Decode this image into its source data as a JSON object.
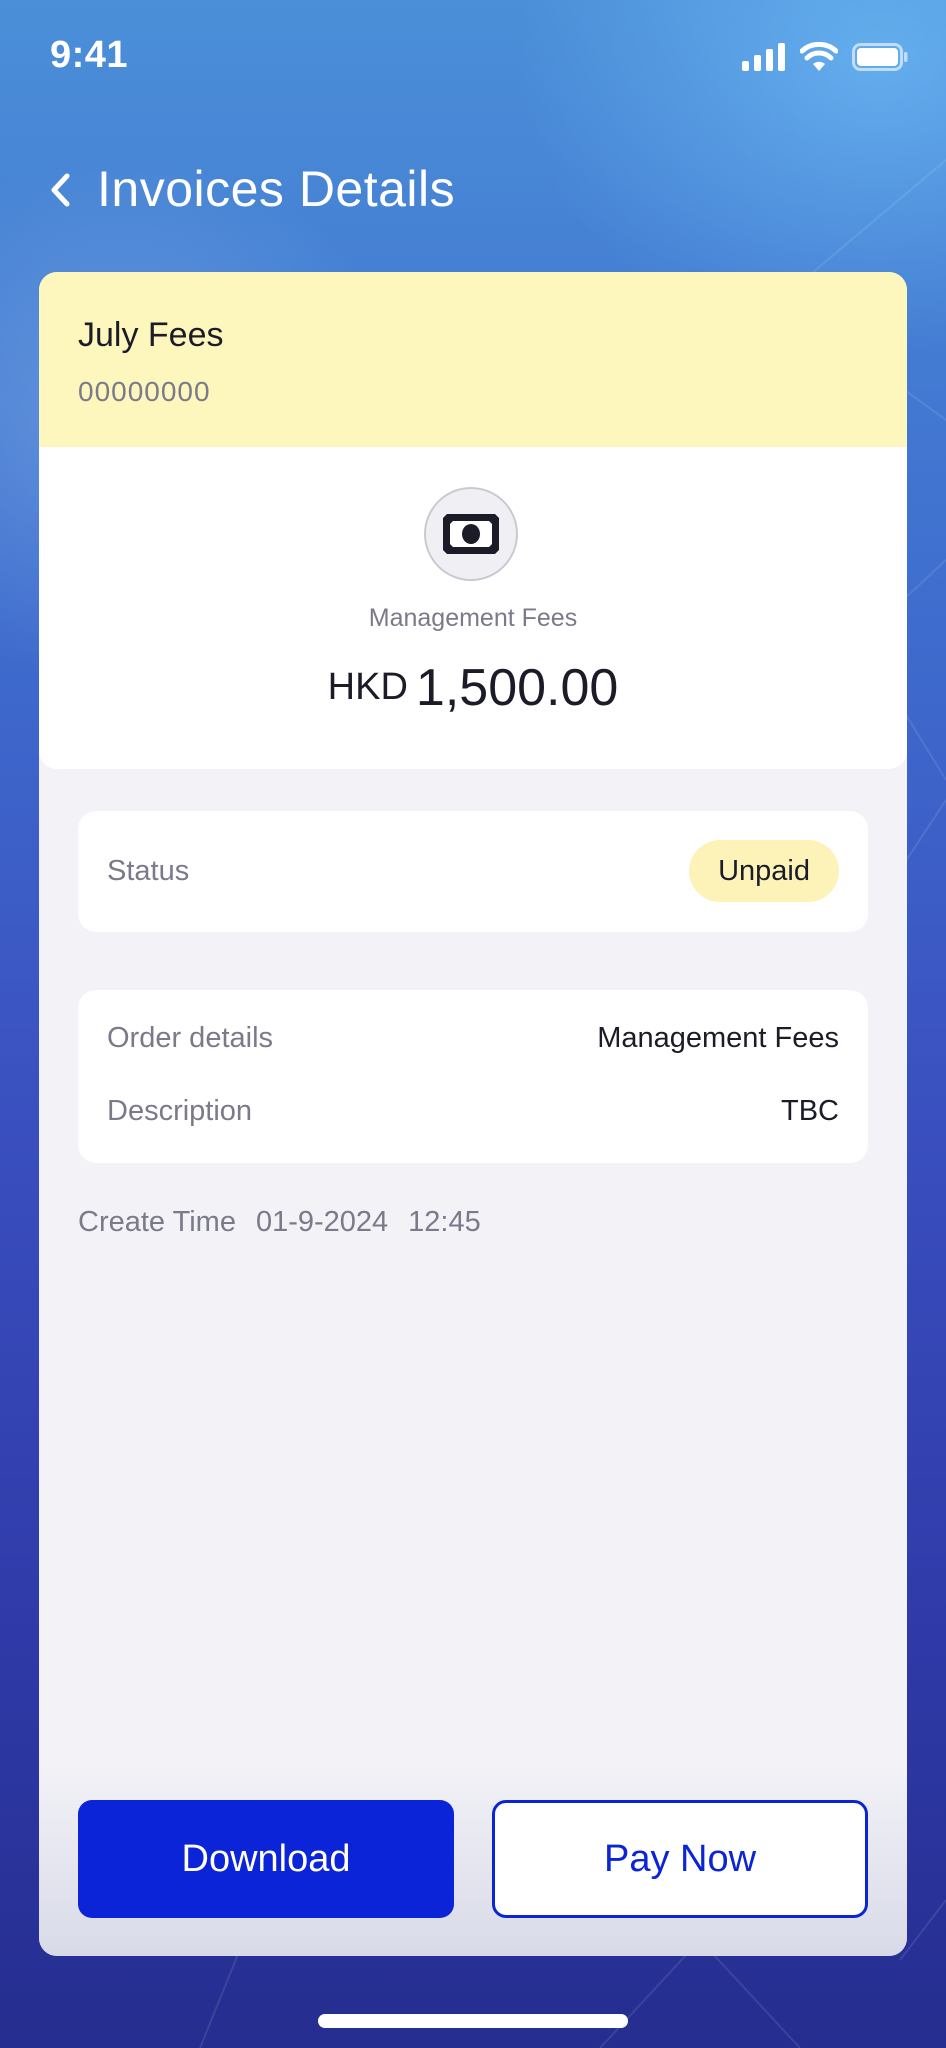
{
  "status_bar": {
    "time": "9:41",
    "icons": [
      "signal-icon",
      "wifi-icon",
      "battery-icon"
    ]
  },
  "header": {
    "title": "Invoices Details",
    "back_icon": "chevron-left-icon"
  },
  "invoice": {
    "name": "July Fees",
    "number": "00000000",
    "icon": "cash-icon",
    "category": "Management Fees",
    "currency": "HKD",
    "amount": "1,500.00"
  },
  "status": {
    "label": "Status",
    "value": "Unpaid"
  },
  "details": {
    "order_label": "Order details",
    "order_value": "Management Fees",
    "description_label": "Description",
    "description_value": "TBC"
  },
  "create_time": {
    "label": "Create Time",
    "date": "01-9-2024",
    "time": "12:45"
  },
  "actions": {
    "download_label": "Download",
    "pay_label": "Pay Now"
  },
  "colors": {
    "accent": "#0b24d8",
    "card_header": "#fdf6bd",
    "status_badge": "#fdf3b8"
  }
}
